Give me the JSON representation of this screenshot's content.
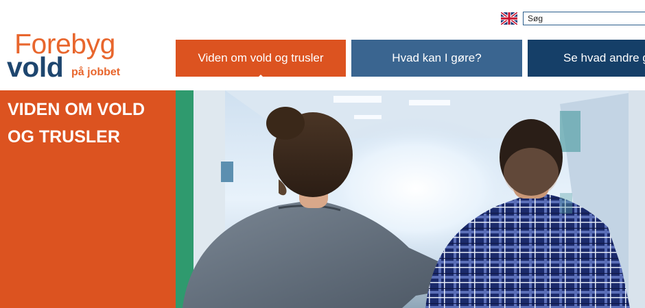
{
  "language": {
    "icon": "uk-flag-icon"
  },
  "search": {
    "placeholder": "Søg",
    "value": ""
  },
  "logo": {
    "line1": "Forebyg",
    "line2": "vold",
    "line3": "på jobbet"
  },
  "nav": [
    {
      "label": "Viden om vold og trusler",
      "active": true
    },
    {
      "label": "Hvad kan I gøre?",
      "active": false
    },
    {
      "label": "Se hvad andre g",
      "active": false
    }
  ],
  "side": {
    "title": "VIDEN OM VOLD OG TRUSLER"
  },
  "hero": {
    "description": "two people walking down a hospital corridor, seen from behind"
  },
  "colors": {
    "orange": "#dc5320",
    "logo_orange": "#e8662d",
    "blue_mid": "#3a6590",
    "blue_dark": "#153f68",
    "logo_blue": "#1e466f"
  }
}
